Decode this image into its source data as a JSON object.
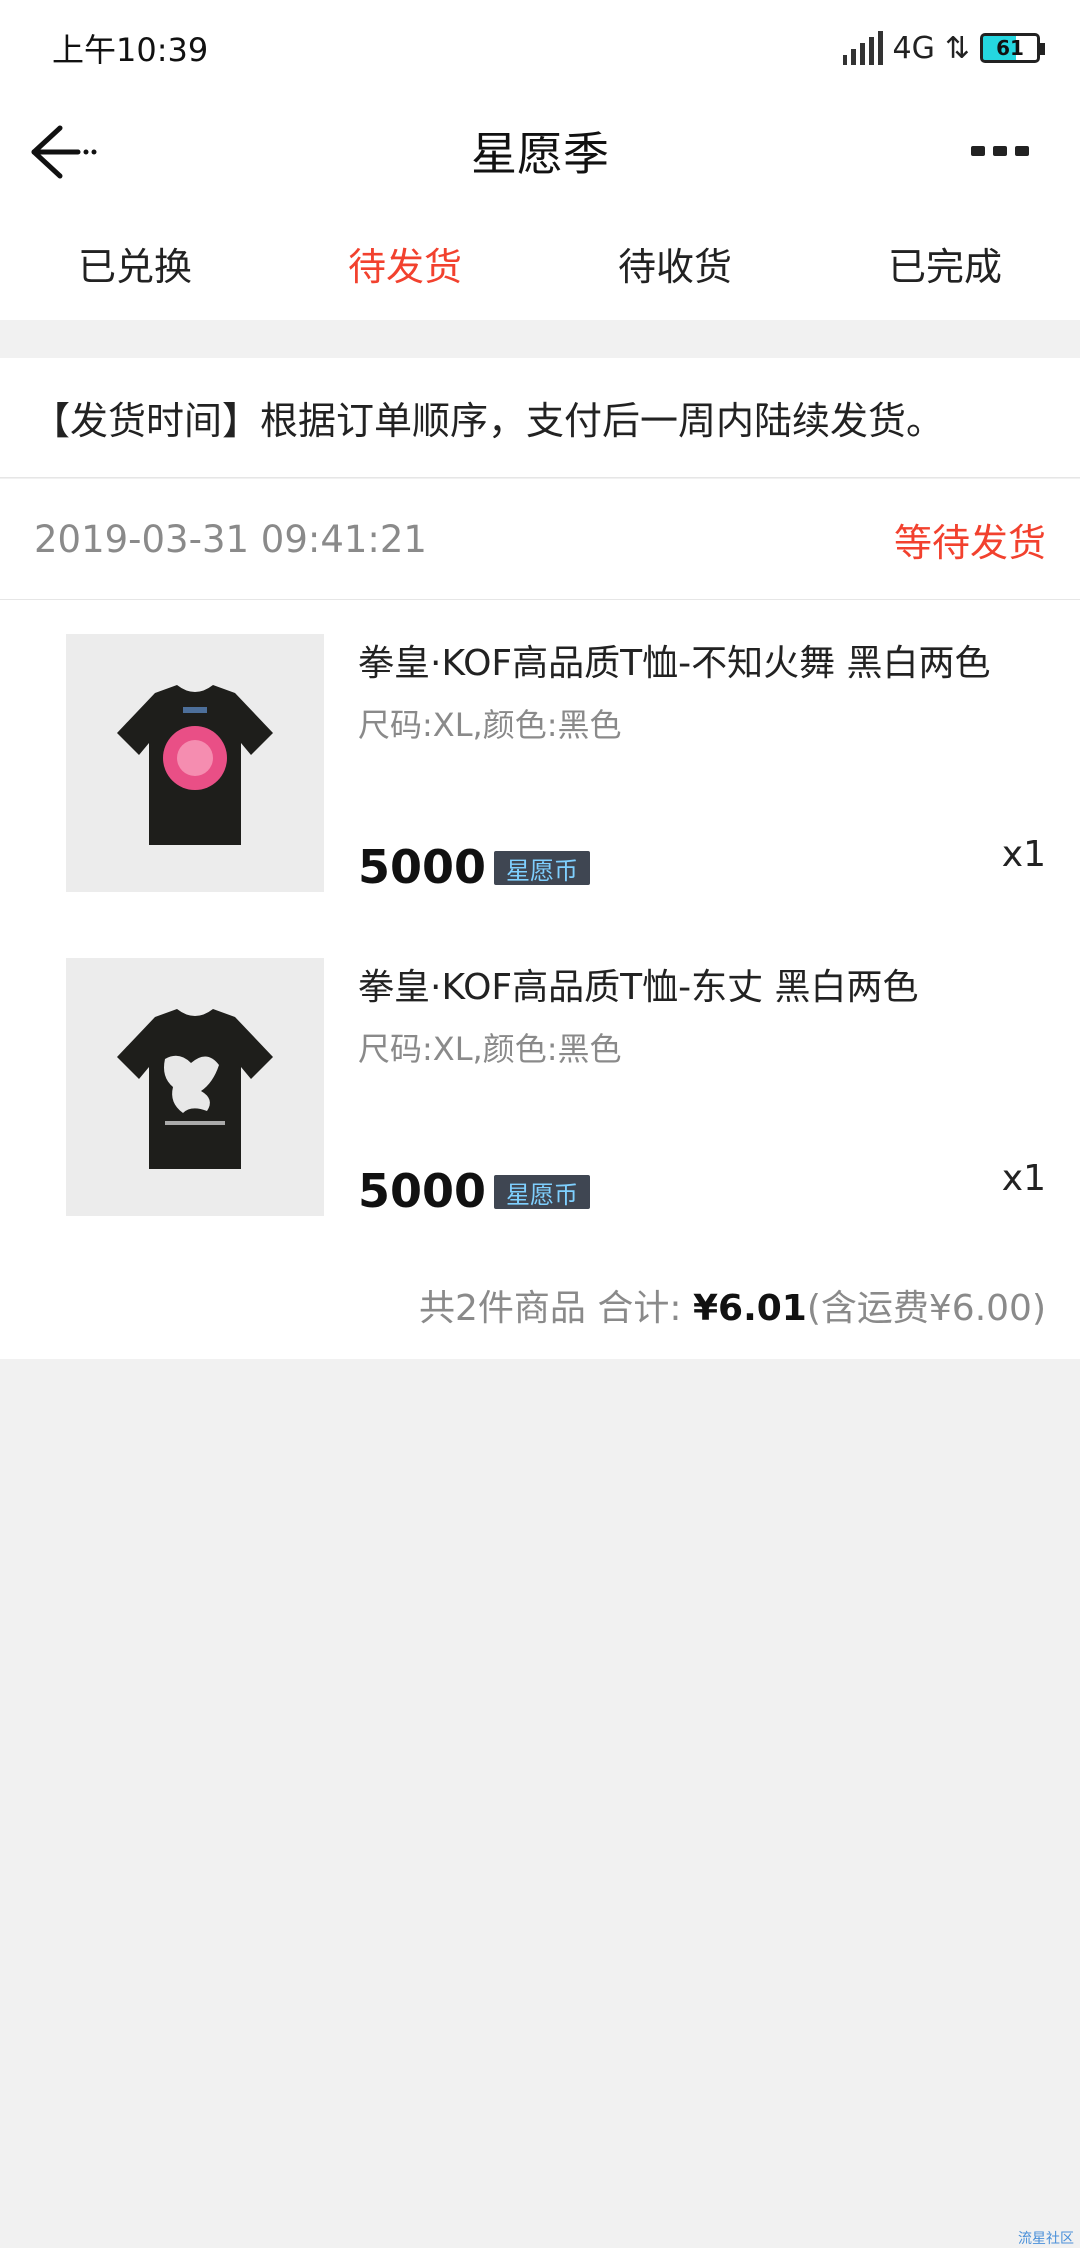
{
  "status": {
    "time": "上午10:39",
    "network": "4G",
    "battery": "61"
  },
  "header": {
    "title": "星愿季",
    "back_icon": "arrow-left-icon",
    "more_icon": "more-dots-icon"
  },
  "tabs": [
    {
      "label": "已兑换",
      "active": false
    },
    {
      "label": "待发货",
      "active": true
    },
    {
      "label": "待收货",
      "active": false
    },
    {
      "label": "已完成",
      "active": false
    }
  ],
  "notice": "【发货时间】根据订单顺序，支付后一周内陆续发货。",
  "order": {
    "time": "2019-03-31 09:41:21",
    "status": "等待发货",
    "items": [
      {
        "name": "拳皇·KOF高品质T恤-不知火舞 黑白两色",
        "spec": "尺码:XL,颜色:黑色",
        "price": "5000",
        "currency": "星愿币",
        "qty": "x1"
      },
      {
        "name": "拳皇·KOF高品质T恤-东丈 黑白两色",
        "spec": "尺码:XL,颜色:黑色",
        "price": "5000",
        "currency": "星愿币",
        "qty": "x1"
      }
    ],
    "summary": {
      "count_text": "共2件商品 合计:",
      "total": "¥6.01",
      "shipping_text": "(含运费¥6.00)"
    }
  },
  "watermark": "流星社区",
  "colors": {
    "accent": "#f2412e",
    "badge_bg": "#3f4652"
  }
}
